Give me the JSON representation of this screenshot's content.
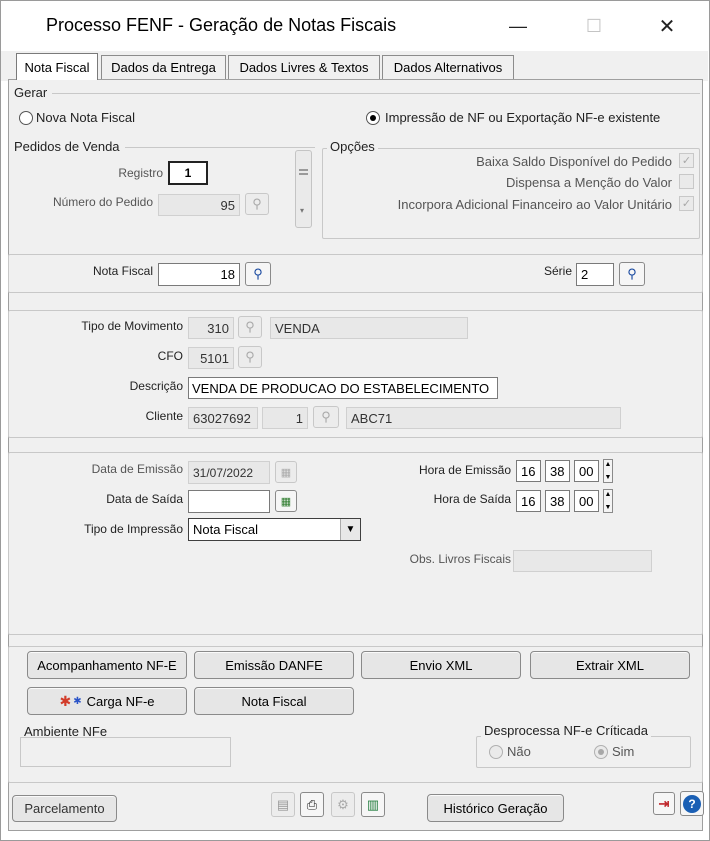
{
  "window": {
    "title": "Processo FENF - Geração de Notas Fiscais",
    "minimize": "—",
    "maximize": "☐",
    "close": "✕"
  },
  "tabs": [
    {
      "label": "Nota Fiscal"
    },
    {
      "label": "Dados da Entrega"
    },
    {
      "label": "Dados Livres & Textos"
    },
    {
      "label": "Dados Alternativos"
    }
  ],
  "gerar": {
    "title": "Gerar",
    "opt_nova": "Nova Nota Fiscal",
    "opt_impressao": "Impressão de NF ou Exportação NF-e existente",
    "selected": "impressao"
  },
  "pedidos": {
    "title": "Pedidos de Venda",
    "registro_label": "Registro",
    "registro_value": "1",
    "numero_label": "Número do Pedido",
    "numero_value": "95"
  },
  "opcoes": {
    "title": "Opções",
    "items": [
      {
        "label": "Baixa Saldo Disponível do Pedido",
        "checked": true
      },
      {
        "label": "Dispensa a Menção do Valor",
        "checked": false
      },
      {
        "label": "Incorpora Adicional Financeiro ao Valor Unitário",
        "checked": true
      }
    ]
  },
  "nota": {
    "nf_label": "Nota Fiscal",
    "nf_value": "18",
    "serie_label": "Série",
    "serie_value": "2"
  },
  "movimento": {
    "tipo_label": "Tipo de Movimento",
    "tipo_code": "310",
    "tipo_desc": "VENDA",
    "cfo_label": "CFO",
    "cfo_value": "5101",
    "descricao_label": "Descrição",
    "descricao_value": "VENDA DE PRODUCAO DO ESTABELECIMENTO",
    "cliente_label": "Cliente",
    "cliente_code": "63027692",
    "cliente_seq": "1",
    "cliente_name": "ABC71"
  },
  "datas": {
    "emissao_label": "Data de Emissão",
    "emissao_value": "31/07/2022",
    "saida_label": "Data de Saída",
    "saida_value": "",
    "tipo_impressao_label": "Tipo de Impressão",
    "tipo_impressao_value": "Nota Fiscal",
    "hora_emissao_label": "Hora de Emissão",
    "hora_emissao": [
      "16",
      "38",
      "00"
    ],
    "hora_saida_label": "Hora de Saída",
    "hora_saida": [
      "16",
      "38",
      "00"
    ],
    "obs_label": "Obs. Livros Fiscais",
    "obs_value": ""
  },
  "actions": {
    "acompanhamento": "Acompanhamento NF-E",
    "emissao_danfe": "Emissão DANFE",
    "envio_xml": "Envio XML",
    "extrair_xml": "Extrair XML",
    "carga_nfe": "Carga NF-e",
    "nota_fiscal": "Nota Fiscal"
  },
  "ambiente": {
    "title": "Ambiente NFe",
    "value": ""
  },
  "desprocessa": {
    "title": "Desprocessa NF-e Críticada",
    "opt_nao": "Não",
    "opt_sim": "Sim",
    "selected": "sim"
  },
  "footer": {
    "parcelamento": "Parcelamento",
    "historico": "Histórico Geração"
  },
  "colors": {
    "accent_blue": "#1a5fb4",
    "exit_red": "#c0282d",
    "panel_bg": "#f0f0f0"
  }
}
